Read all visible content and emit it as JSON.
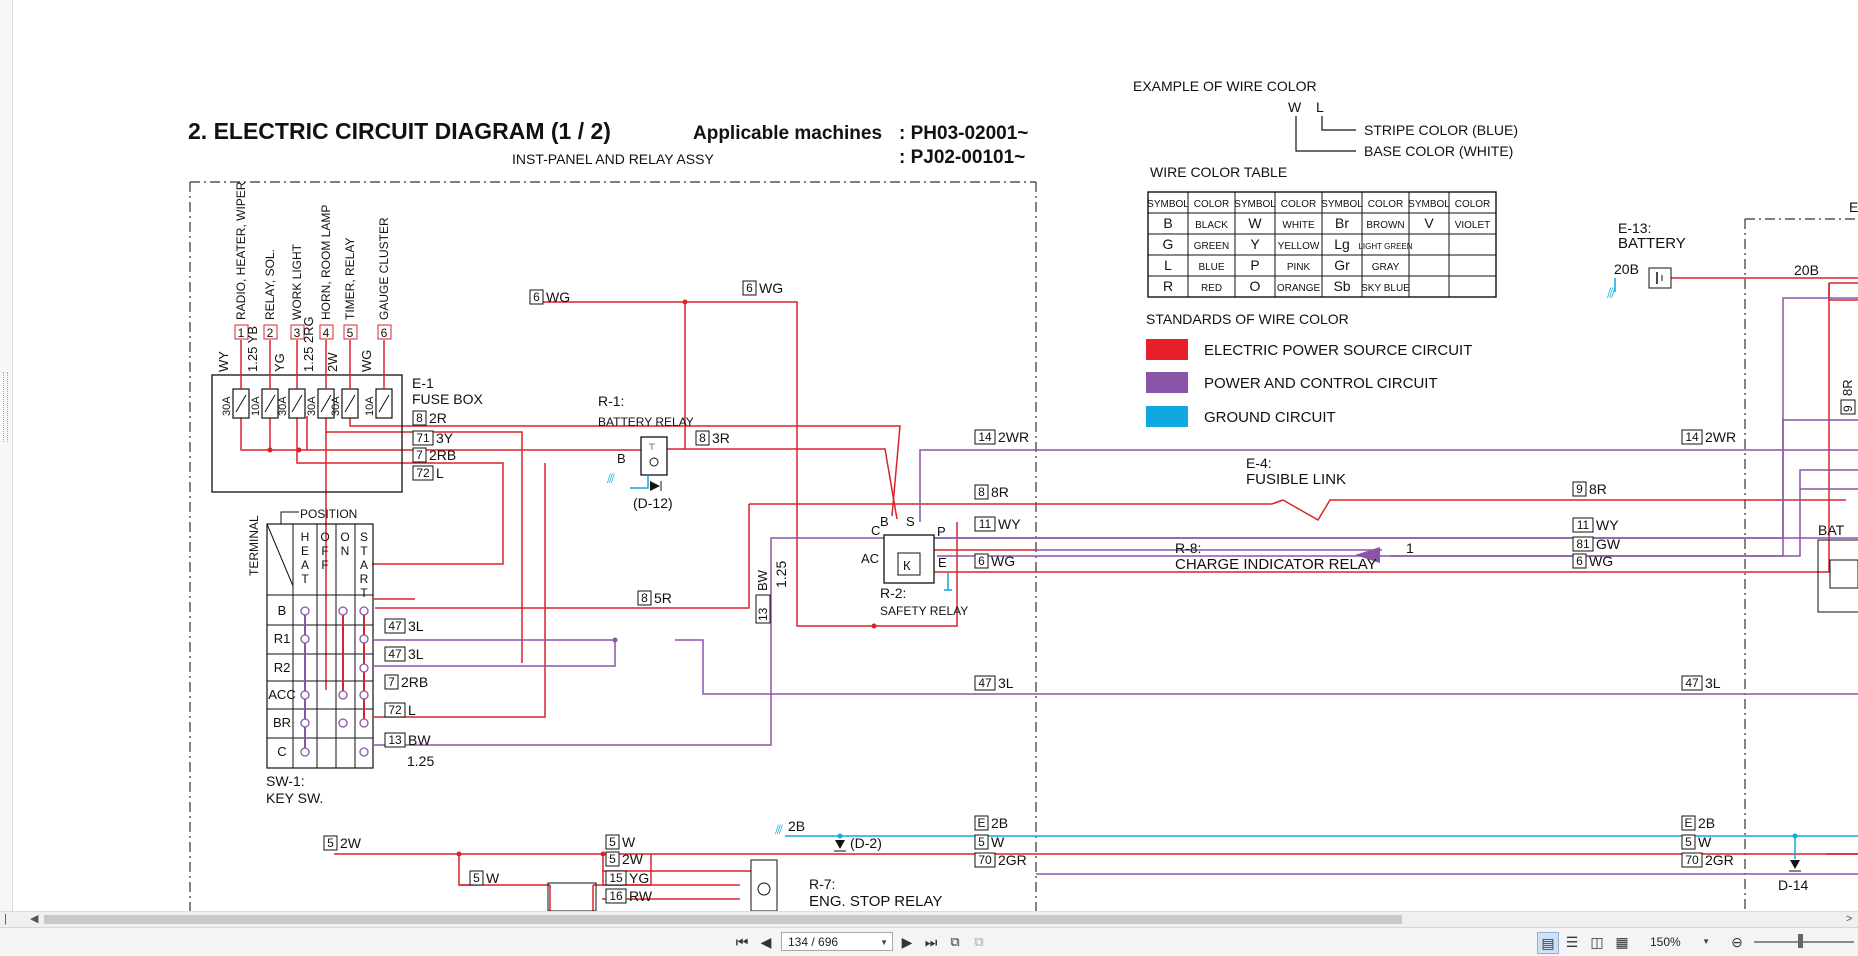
{
  "title": {
    "heading": "2.  ELECTRIC CIRCUIT DIAGRAM (1 / 2)",
    "applicable_label": "Applicable machines",
    "serial1": ": PH03-02001~",
    "serial2": ": PJ02-00101~",
    "subtitle": "INST-PANEL AND RELAY ASSY"
  },
  "example": {
    "title": "EXAMPLE OF WIRE COLOR",
    "w": "W",
    "l": "L",
    "stripe": "STRIPE COLOR (BLUE)",
    "base": "BASE COLOR (WHITE)"
  },
  "color_table": {
    "title": "WIRE COLOR TABLE",
    "headers": [
      "SYMBOL",
      "COLOR",
      "SYMBOL",
      "COLOR",
      "SYMBOL",
      "COLOR",
      "SYMBOL",
      "COLOR"
    ],
    "rows": [
      [
        "B",
        "BLACK",
        "W",
        "WHITE",
        "Br",
        "BROWN",
        "V",
        "VIOLET"
      ],
      [
        "G",
        "GREEN",
        "Y",
        "YELLOW",
        "Lg",
        "LIGHT GREEN",
        "",
        ""
      ],
      [
        "L",
        "BLUE",
        "P",
        "PINK",
        "Gr",
        "GRAY",
        "",
        ""
      ],
      [
        "R",
        "RED",
        "O",
        "ORANGE",
        "Sb",
        "SKY BLUE",
        "",
        ""
      ]
    ]
  },
  "standards": {
    "title": "STANDARDS OF WIRE COLOR",
    "items": [
      {
        "label": "ELECTRIC POWER SOURCE CIRCUIT",
        "color": "#e8202a"
      },
      {
        "label": "POWER AND CONTROL CIRCUIT",
        "color": "#8a55a8"
      },
      {
        "label": "GROUND CIRCUIT",
        "color": "#10a8e0"
      }
    ]
  },
  "fuse_box": {
    "name": "E-1",
    "label": "FUSE BOX",
    "circuits": [
      "RADIO, HEATER, WIPER",
      "RELAY, SOL.",
      "WORK LIGHT",
      "HORN, ROOM LAMP",
      "TIMER, RELAY",
      "GAUGE CLUSTER"
    ],
    "numbers": [
      "1",
      "2",
      "3",
      "4",
      "5",
      "6"
    ],
    "wires": [
      "WY",
      "1.25 YB",
      "YG",
      "1.25 2RG",
      "2W",
      "WG"
    ],
    "amps": [
      "30A",
      "10A",
      "30A",
      "30A",
      "30A",
      "10A"
    ]
  },
  "key_switch": {
    "name": "SW-1:",
    "label": "KEY SW.",
    "terminal_label": "TERMINAL",
    "position_label": "POSITION",
    "positions": [
      "HEAT",
      "OFF",
      "ON",
      "START"
    ],
    "rows": [
      "B",
      "R1",
      "R2",
      "ACC",
      "BR",
      "C"
    ]
  },
  "components": {
    "battery_relay": {
      "name": "R-1:",
      "label": "BATTERY RELAY",
      "diode": "(D-12)",
      "ground": "B"
    },
    "safety_relay": {
      "name": "R-2:",
      "label": "SAFETY RELAY",
      "b": "B",
      "s": "S",
      "c": "C",
      "p": "P",
      "ac": "AC",
      "e": "E"
    },
    "fusible_link": {
      "name": "E-4:",
      "label": "FUSIBLE LINK"
    },
    "charge_relay": {
      "name": "R-8:",
      "label": "CHARGE INDICATOR RELAY",
      "pin": "1"
    },
    "battery": {
      "name": "E-13:",
      "label": "BATTERY",
      "wire": "20B",
      "wire2": "20B"
    },
    "eng_stop_relay": {
      "name": "R-7:",
      "label": "ENG. STOP RELAY"
    },
    "diode_d2": "(D-2)",
    "diode_d14": "D-14",
    "bat_label": "BAT",
    "edge_e": "E"
  },
  "wire_labels": [
    {
      "num": "6",
      "text": "WG"
    },
    {
      "num": "6",
      "text": "WG"
    },
    {
      "num": "8",
      "text": "2R"
    },
    {
      "num": "71",
      "text": "3Y"
    },
    {
      "num": "7",
      "text": "2RB"
    },
    {
      "num": "72",
      "text": "L"
    },
    {
      "num": "8",
      "text": "3R"
    },
    {
      "num": "14",
      "text": "2WR"
    },
    {
      "num": "8",
      "text": "8R"
    },
    {
      "num": "11",
      "text": "WY"
    },
    {
      "num": "6",
      "text": "WG"
    },
    {
      "num": "8",
      "text": "5R"
    },
    {
      "num": "13",
      "text": "BW"
    },
    {
      "num": "47",
      "text": "3L"
    },
    {
      "num": "47",
      "text": "3L"
    },
    {
      "num": "7",
      "text": "2RB"
    },
    {
      "num": "72",
      "text": "L"
    },
    {
      "num": "13",
      "text": "BW"
    },
    {
      "num": "47",
      "text": "3L"
    },
    {
      "num": "14",
      "text": "2WR"
    },
    {
      "num": "9",
      "text": "8R"
    },
    {
      "num": "11",
      "text": "WY"
    },
    {
      "num": "81",
      "text": "GW"
    },
    {
      "num": "6",
      "text": "WG"
    },
    {
      "num": "47",
      "text": "3L"
    },
    {
      "num": "5",
      "text": "2W"
    },
    {
      "num": "5",
      "text": "W"
    },
    {
      "num": "5",
      "text": "2W"
    },
    {
      "num": "5",
      "text": "W"
    },
    {
      "num": "15",
      "text": "YG"
    },
    {
      "num": "16",
      "text": "RW"
    },
    {
      "num": "E",
      "text": "2B"
    },
    {
      "num": "5",
      "text": "W"
    },
    {
      "num": "70",
      "text": "2GR"
    },
    {
      "num": "E",
      "text": "2B"
    },
    {
      "num": "5",
      "text": "W"
    },
    {
      "num": "70",
      "text": "2GR"
    },
    {
      "num": "9",
      "text": "8R"
    }
  ],
  "misc": {
    "bw_size": "1.25",
    "bw_size2": "1.25",
    "ground_2b": "2B"
  },
  "viewer": {
    "page_display": "134 / 696",
    "zoom": "150%"
  }
}
